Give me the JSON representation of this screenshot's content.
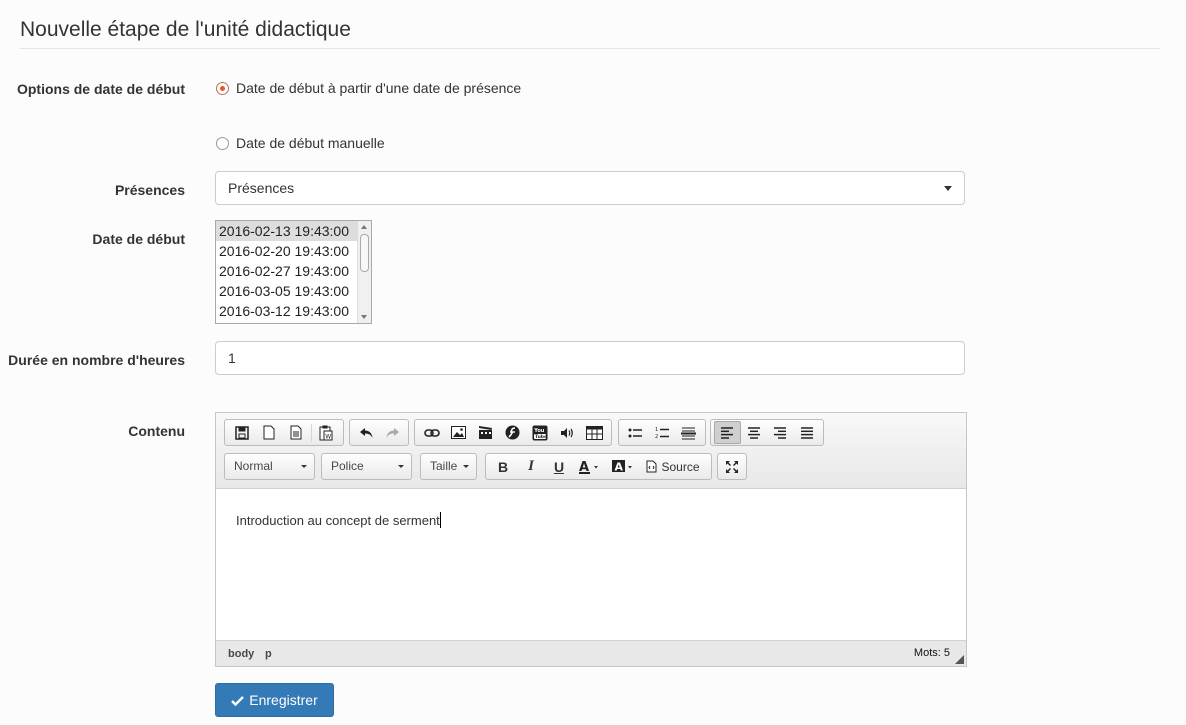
{
  "page": {
    "title": "Nouvelle étape de l'unité didactique"
  },
  "form": {
    "start_date_options": {
      "label": "Options de date de début",
      "options": [
        {
          "label": "Date de début à partir d'une date de présence",
          "checked": true
        },
        {
          "label": "Date de début manuelle",
          "checked": false
        }
      ]
    },
    "presences": {
      "label": "Présences",
      "selected": "Présences"
    },
    "start_date": {
      "label": "Date de début",
      "options": [
        "2016-02-13 19:43:00",
        "2016-02-20 19:43:00",
        "2016-02-27 19:43:00",
        "2016-03-05 19:43:00",
        "2016-03-12 19:43:00"
      ],
      "selected": "2016-02-13 19:43:00"
    },
    "duration": {
      "label": "Durée en nombre d'heures",
      "value": "1"
    },
    "content": {
      "label": "Contenu",
      "editor": {
        "toolbar_row1": {
          "document": [
            "save-icon",
            "new-page-icon",
            "templates-icon",
            "paste-word-icon"
          ],
          "history": [
            "undo-icon",
            "redo-icon"
          ],
          "insert": [
            "link-icon",
            "image-icon",
            "video-icon",
            "flash-icon",
            "youtube-icon",
            "audio-icon",
            "table-icon"
          ],
          "lists": [
            "bulleted-list-icon",
            "numbered-list-icon",
            "horizontal-rule-icon"
          ],
          "align": [
            "align-left-icon",
            "align-center-icon",
            "align-right-icon",
            "justify-icon"
          ]
        },
        "format_combo": "Normal",
        "font_combo": "Police",
        "size_combo": "Taille",
        "source_label": "Source",
        "body_text": "Introduction au concept de serment",
        "path": [
          "body",
          "p"
        ],
        "word_count": "Mots: 5"
      }
    },
    "submit_label": "Enregistrer"
  },
  "colors": {
    "primary_button": "#337ab7",
    "radio_checked": "#e05a2e"
  }
}
